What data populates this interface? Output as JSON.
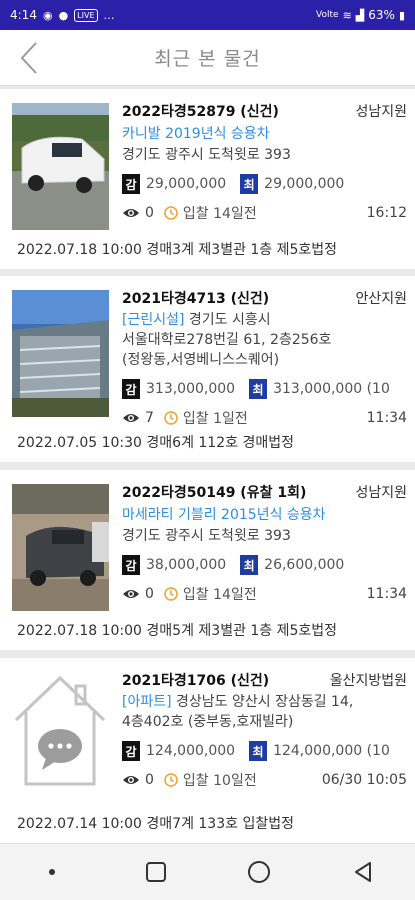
{
  "status_bar": {
    "time": "4:14",
    "live": "LIVE",
    "network": "Volte",
    "battery": "63%"
  },
  "header": {
    "title": "최근 본 물건"
  },
  "items": [
    {
      "case_no": "2022타경52879 (신건)",
      "court": "성남지원",
      "title": "카니발 2019년식 승용차",
      "address_lines": [
        "경기도 광주시 도척윗로 393"
      ],
      "appraisal_label": "감",
      "appraisal_price": "29,000,000",
      "min_label": "최",
      "min_price": "29,000,000",
      "views": "0",
      "bid_day": "입찰 14일전",
      "time": "16:12",
      "footer": "2022.07.18 10:00   경매3계   제3별관 1층 제5호법정"
    },
    {
      "case_no": "2021타경4713 (신건)",
      "court": "안산지원",
      "category": "[근린시설]",
      "address_lines": [
        "경기도 시흥시",
        "서울대학로278번길 61, 2층256호",
        "(정왕동,서영베니스스퀘어)"
      ],
      "appraisal_label": "감",
      "appraisal_price": "313,000,000",
      "min_label": "최",
      "min_price": "313,000,000 (10",
      "views": "7",
      "bid_day": "입찰 1일전",
      "time": "11:34",
      "footer": "2022.07.05 10:30   경매6계   112호 경매법정"
    },
    {
      "case_no": "2022타경50149 (유찰 1회)",
      "court": "성남지원",
      "title": "마세라티 기블리 2015년식 승용차",
      "address_lines": [
        "경기도 광주시 도척윗로 393"
      ],
      "appraisal_label": "감",
      "appraisal_price": "38,000,000",
      "min_label": "최",
      "min_price": "26,600,000",
      "views": "0",
      "bid_day": "입찰 14일전",
      "time": "11:34",
      "footer": "2022.07.18 10:00   경매5계   제3별관 1층 제5호법정"
    },
    {
      "case_no": "2021타경1706 (신건)",
      "court": "울산지방법원",
      "category": "[아파트]",
      "address_lines": [
        "경상남도 양산시 장삼동길 14,",
        "4층402호 (중부동,호재빌라)"
      ],
      "appraisal_label": "감",
      "appraisal_price": "124,000,000",
      "min_label": "최",
      "min_price": "124,000,000 (10",
      "views": "0",
      "bid_day": "입찰 10일전",
      "time": "06/30 10:05",
      "footer": "2022.07.14 10:00   경매7계   133호 입찰법정"
    }
  ],
  "nav": {
    "recents": "recents-icon",
    "home": "home-icon",
    "back": "back-icon",
    "menu": "menu-icon"
  }
}
